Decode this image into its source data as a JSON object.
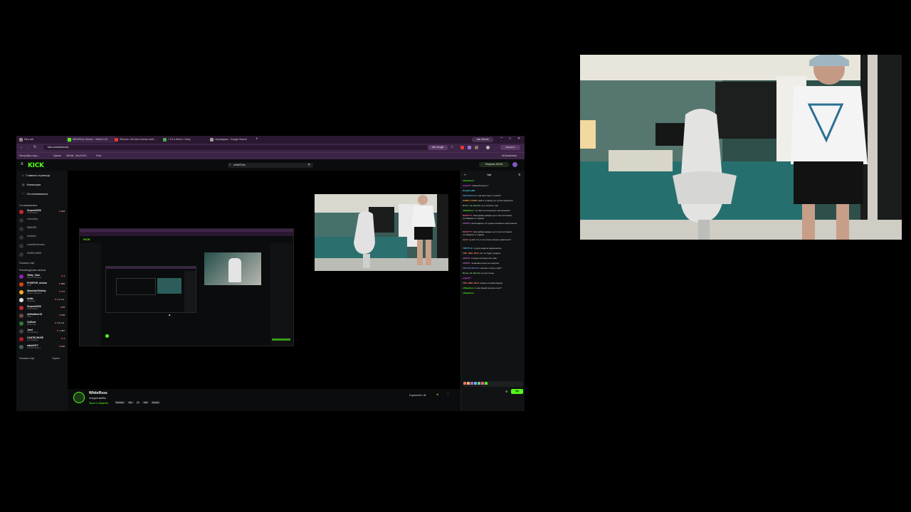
{
  "browser": {
    "tabs": [
      {
        "label": "New tab",
        "color": "#888888",
        "active": false
      },
      {
        "label": "WhiteRoss Stream - Watch Live",
        "color": "#53fc18",
        "active": true
      },
      {
        "label": "Shazam: the best shazam stuff ...",
        "color": "#e53935",
        "active": false
      },
      {
        "label": "» Fit a Week » Hoby",
        "color": "#4caf50",
        "active": false
      },
      {
        "label": "переводчик - Google Search",
        "color": "#9e9e9e",
        "active": false
      }
    ],
    "ask_gemini": "Ask Gemini",
    "url": "kick.com/whiteross",
    "ask_google": "Ask Google",
    "all_bookmarks": "All Bookmarks",
    "bookmarks": [
      "Настройки и про...",
      "Группа",
      "GitHub - Key-M Wi...",
      "Chat"
    ]
  },
  "kick": {
    "logo": "KICK",
    "search_value": "whiteRoss",
    "get_kicks": "Получить KICKs",
    "nav": [
      "Главная страница",
      "Навигация",
      "Отслеживаемое"
    ],
    "followed_title": "Отслеживаемые",
    "followed": [
      {
        "name": "Serpent2026",
        "cat": "Just Chatting",
        "viewers": "104",
        "live": true,
        "color": "#c62828"
      },
      {
        "name": "clonedisy",
        "cat": "",
        "viewers": "",
        "live": false,
        "color": "#555555"
      },
      {
        "name": "MINORU",
        "cat": "",
        "viewers": "",
        "live": false,
        "color": "#555555"
      },
      {
        "name": "lolibitch",
        "cat": "",
        "viewers": "",
        "live": false,
        "color": "#555555"
      },
      {
        "name": "smartfisherman",
        "cat": "",
        "viewers": "",
        "live": false,
        "color": "#555555"
      },
      {
        "name": "DARKLAWIS",
        "cat": "",
        "viewers": "",
        "live": false,
        "color": "#555555"
      }
    ],
    "show_more": "Показать ещё",
    "recommended_title": "Рекомендуемые каналы",
    "recommended": [
      {
        "name": "Vitaly_Olan",
        "cat": "Просто общение",
        "viewers": "2",
        "color": "#8e24aa"
      },
      {
        "name": "POKIFOR_siruma",
        "cat": "Slots",
        "viewers": "696",
        "color": "#d84315"
      },
      {
        "name": "StanislavTwitchy",
        "cat": "Просто общение",
        "viewers": "777",
        "color": "#f9a825"
      },
      {
        "name": "Imitte",
        "cat": "Аудиория",
        "viewers": "1,1 тыс.",
        "color": "#e0e0e0"
      },
      {
        "name": "Serpent2026",
        "cat": "Just Chatting",
        "viewers": "94",
        "color": "#c62828"
      },
      {
        "name": "mihhailmer24",
        "cat": "Slots",
        "viewers": "105",
        "color": "#6d4c41"
      },
      {
        "name": "CoBeek",
        "cat": "World Cup",
        "viewers": "1,5 тыс.",
        "color": "#2e7d32"
      },
      {
        "name": "Jarol",
        "cat": "Just Chatting",
        "viewers": "1,397",
        "color": "#37474f"
      },
      {
        "name": "CANTECHUSE",
        "cat": "Just Chatting",
        "viewers": "2",
        "color": "#b71c1c"
      },
      {
        "name": "watchNTY",
        "cat": "Counter-Strike 2",
        "viewers": "102",
        "color": "#455a64"
      }
    ],
    "show_more2": "Показать ещё",
    "collapse": "Скрыть",
    "streamer": "WhiteRoss",
    "stream_title": "сегодня вайбы",
    "stream_category": "Просто общение",
    "tags": [
      "Russian",
      "18+",
      "irl",
      "chill",
      "Russia"
    ],
    "viewers": "5 зрителей • 46"
  },
  "chat": {
    "title": "Чат",
    "messages": [
      {
        "user": "nfhuprikos:",
        "text": "",
        "color": "#53fc18"
      },
      {
        "user": "pngHTT:",
        "text": "главный выход ?",
        "color": "#e040fb"
      },
      {
        "user": "KingTreeBR:",
        "text": "",
        "color": "#4dd0e1"
      },
      {
        "user": "hachimnovorr:",
        "text": "как простоять в часах?",
        "color": "#64b5f6"
      },
      {
        "user": "CAIRO_COSS:",
        "text": "выйти в сверху не лучше варианта",
        "color": "#ffb74d"
      },
      {
        "user": "Dreas_de_Burola:",
        "text": "ну и сколько там",
        "color": "#81c784"
      },
      {
        "user": "nfhuprikos:",
        "text": "что вас не интересует настроение?",
        "color": "#53fc18"
      },
      {
        "user": "MOKITTY:",
        "text": "Настройка камеры не в том состоянии, отставание от подачи",
        "color": "#f06292"
      },
      {
        "user": "AWIITS:",
        "text": "восхищаюсь что нужно на вашего настроения",
        "color": "#ba68c8"
      },
      {
        "user": "MOKITTY:",
        "text": "Настройка камеры не в том состоянии, отставание от подачи",
        "color": "#f06292"
      },
      {
        "user": "djnfd:",
        "text": "ну вас что-то не очень хорошо довольны?",
        "color": "#e57373"
      },
      {
        "user": "TROTTLE:",
        "text": "в душе видели аудиозапись",
        "color": "#4fc3f7"
      },
      {
        "user": "TOP_BRO_MLG:",
        "text": "вот не будет увидеть",
        "color": "#ff8a65"
      },
      {
        "user": "AWIITS:",
        "text": "в конце на верху все таки",
        "color": "#ba68c8"
      },
      {
        "user": "AWIITS:",
        "text": "за время ничего не смотрел",
        "color": "#ba68c8"
      },
      {
        "user": "PRAVAKTRUCH:",
        "text": "сколько отпуск у вас?",
        "color": "#7986cb"
      },
      {
        "user": "Dreas_de_Burola:",
        "text": "ну все очень",
        "color": "#81c784"
      },
      {
        "user": "pngHTT:",
        "text": "",
        "color": "#e040fb"
      },
      {
        "user": "TOP_BRO_MLG:",
        "text": "начало стрима видено",
        "color": "#ff8a65"
      },
      {
        "user": "nfhuprikos:",
        "text": "а как самый сколько опыт?",
        "color": "#53fc18"
      },
      {
        "user": "nfhuprikos:",
        "text": "",
        "color": "#53fc18"
      }
    ],
    "input_placeholder": "Отправить сообщение",
    "send_label": "Чат"
  }
}
